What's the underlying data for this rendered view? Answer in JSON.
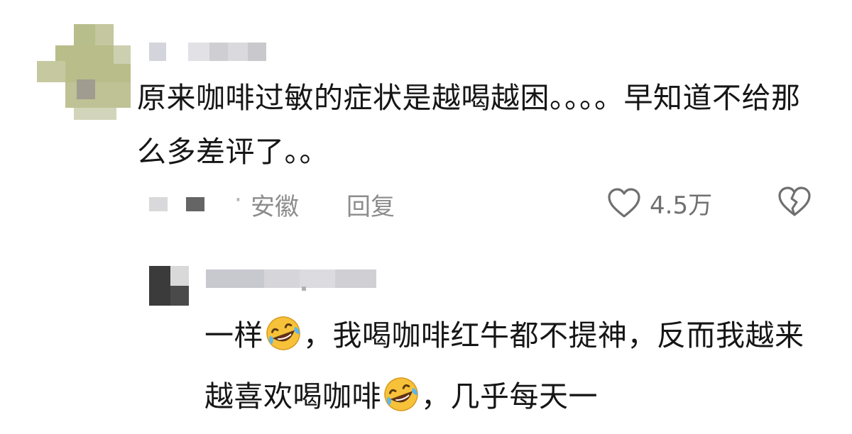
{
  "main_comment": {
    "text": "原来咖啡过敏的症状是越喝越困。。。。早知道不给那么多差评了。。",
    "location": "安徽",
    "reply_label": "回复",
    "like_count": "4.5万",
    "dot": "·"
  },
  "reply_comment": {
    "segments": [
      {
        "type": "text",
        "value": "一样"
      },
      {
        "type": "emoji",
        "name": "rolling-on-floor-laughing-emoji"
      },
      {
        "type": "text",
        "value": "，我喝咖啡红牛都不提神，反而我越来越喜欢喝咖啡"
      },
      {
        "type": "emoji",
        "name": "rolling-on-floor-laughing-emoji"
      },
      {
        "type": "text",
        "value": "，几乎每天一"
      }
    ]
  },
  "icons": {
    "like": "heart-outline-icon",
    "dislike": "broken-heart-icon"
  },
  "colors": {
    "text_primary": "#161616",
    "text_secondary": "#8c8c8c",
    "like_count": "#707070",
    "emoji_face": "#f7c23a"
  }
}
